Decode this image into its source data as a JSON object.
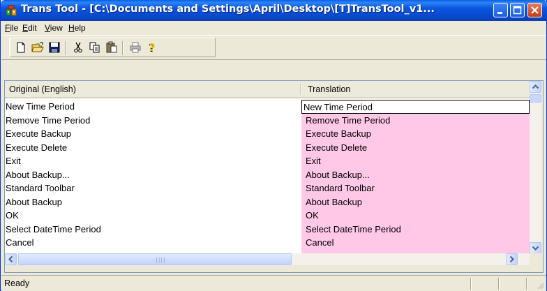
{
  "window": {
    "title": "Trans Tool - [C:\\Documents and Settings\\April\\Desktop\\[T]TransTool_v1..."
  },
  "menu": {
    "items": [
      {
        "label": "File"
      },
      {
        "label": "Edit"
      },
      {
        "label": "View"
      },
      {
        "label": "Help"
      }
    ]
  },
  "toolbar": {
    "icons": [
      "new-file-icon",
      "open-folder-icon",
      "save-disk-icon",
      "cut-scissors-icon",
      "copy-icon",
      "paste-icon",
      "print-icon",
      "help-about-icon"
    ]
  },
  "table": {
    "columns": [
      "Original (English)",
      "Translation"
    ],
    "edit_value": "New Time Period",
    "rows": [
      {
        "original": "New Time Period",
        "translation": "New Time Period"
      },
      {
        "original": "Remove Time Period",
        "translation": "Remove Time Period"
      },
      {
        "original": "Execute Backup",
        "translation": "Execute Backup"
      },
      {
        "original": "Execute Delete",
        "translation": "Execute Delete"
      },
      {
        "original": "Exit",
        "translation": "Exit"
      },
      {
        "original": "About Backup...",
        "translation": "About Backup..."
      },
      {
        "original": "Standard Toolbar",
        "translation": "Standard Toolbar"
      },
      {
        "original": "About Backup",
        "translation": "About Backup"
      },
      {
        "original": "OK",
        "translation": "OK"
      },
      {
        "original": "Select DateTime Period",
        "translation": "Select DateTime Period"
      },
      {
        "original": "Cancel",
        "translation": "Cancel"
      }
    ]
  },
  "status": {
    "text": "Ready"
  },
  "colors": {
    "translation_bg": "#ffc8e6",
    "title_blue": "#0a54e0"
  }
}
